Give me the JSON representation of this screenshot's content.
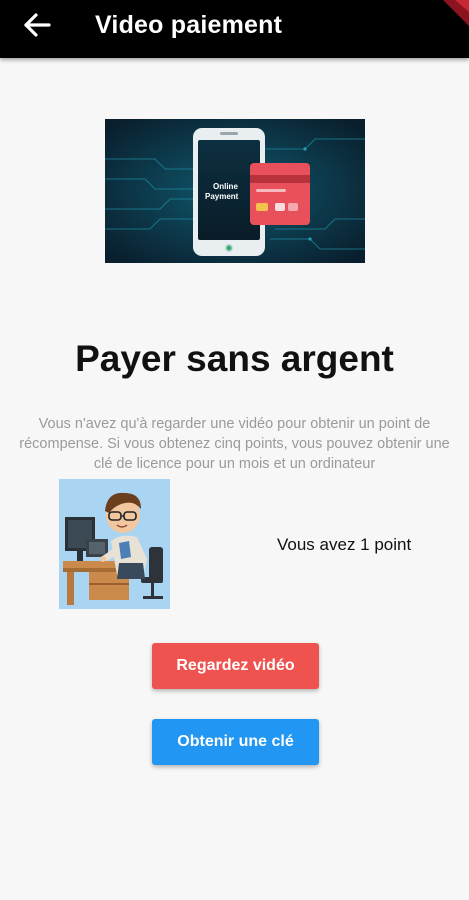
{
  "app_bar": {
    "title": "Video paiement",
    "back_icon": "arrow-left-icon"
  },
  "banner": {
    "caption_line1": "Online",
    "caption_line2": "Payment"
  },
  "main": {
    "headline": "Payer sans argent",
    "description": "Vous n'avez qu'à regarder une vidéo pour obtenir un point de récompense. Si vous obtenez cinq points, vous pouvez obtenir une clé de licence pour un mois et un ordinateur",
    "points_text": "Vous avez 1 point"
  },
  "buttons": {
    "watch_label": "Regardez vidéo",
    "key_label": "Obtenir une clé"
  },
  "colors": {
    "app_bar": "#000000",
    "watch_button": "#ef5350",
    "key_button": "#2196f3",
    "background": "#f7f7f7",
    "description_text": "#9a9a9a"
  }
}
